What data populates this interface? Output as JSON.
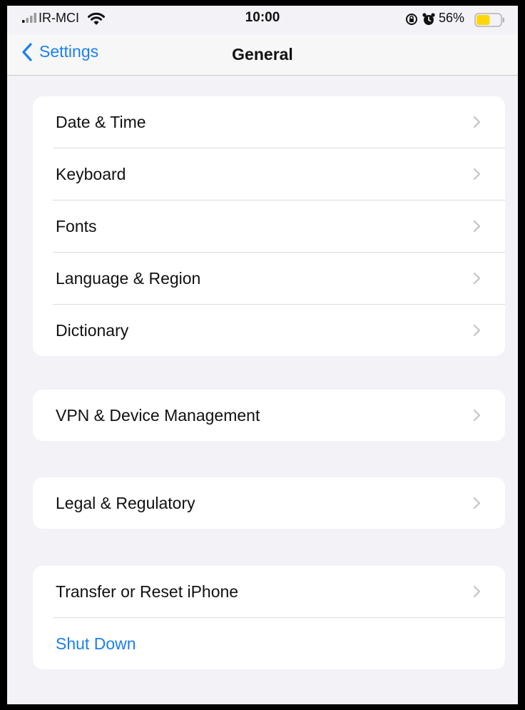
{
  "status_bar": {
    "carrier": "IR-MCI",
    "time": "10:00",
    "battery_percent": "56%",
    "battery_level": 0.56,
    "battery_color": "#ffd60a"
  },
  "nav": {
    "back_label": "Settings",
    "title": "General"
  },
  "groups": [
    {
      "items": [
        {
          "label": "Date & Time",
          "chevron": true
        },
        {
          "label": "Keyboard",
          "chevron": true
        },
        {
          "label": "Fonts",
          "chevron": true
        },
        {
          "label": "Language & Region",
          "chevron": true
        },
        {
          "label": "Dictionary",
          "chevron": true
        }
      ]
    },
    {
      "items": [
        {
          "label": "VPN & Device Management",
          "chevron": true
        }
      ]
    },
    {
      "items": [
        {
          "label": "Legal & Regulatory",
          "chevron": true
        }
      ]
    },
    {
      "items": [
        {
          "label": "Transfer or Reset iPhone",
          "chevron": true
        },
        {
          "label": "Shut Down",
          "chevron": false
        }
      ]
    }
  ],
  "colors": {
    "accent": "#1a7ff3",
    "background": "#f2f2f7",
    "chevron": "#c4c4c8"
  },
  "icons": {
    "signal": "signal-strength-icon",
    "wifi": "wifi-icon",
    "orientation_lock": "orientation-lock-icon",
    "alarm": "alarm-icon",
    "battery": "battery-icon",
    "back": "chevron-left-icon",
    "disclosure": "chevron-right-icon"
  }
}
